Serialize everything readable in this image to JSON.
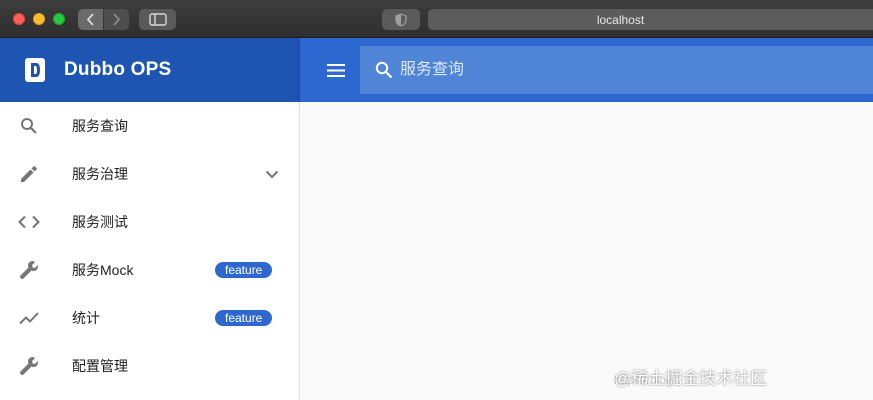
{
  "browser": {
    "url": "localhost"
  },
  "app": {
    "title": "Dubbo OPS"
  },
  "search": {
    "placeholder": "服务查询"
  },
  "sidebar": {
    "items": [
      {
        "label": "服务查询",
        "icon": "search-icon"
      },
      {
        "label": "服务治理",
        "icon": "pencil-icon",
        "expandable": true
      },
      {
        "label": "服务测试",
        "icon": "code-icon"
      },
      {
        "label": "服务Mock",
        "icon": "wrench-icon",
        "badge": "feature"
      },
      {
        "label": "统计",
        "icon": "trending-icon",
        "badge": "feature"
      },
      {
        "label": "配置管理",
        "icon": "wrench-icon"
      }
    ]
  },
  "watermark": {
    "text": "@稀土掘金技术社区",
    "faint": "https://blog"
  },
  "colors": {
    "brand": "#1f55b2",
    "topbar": "#2c68cf",
    "search_bg": "#4f84d6",
    "badge": "#2c68cf"
  }
}
